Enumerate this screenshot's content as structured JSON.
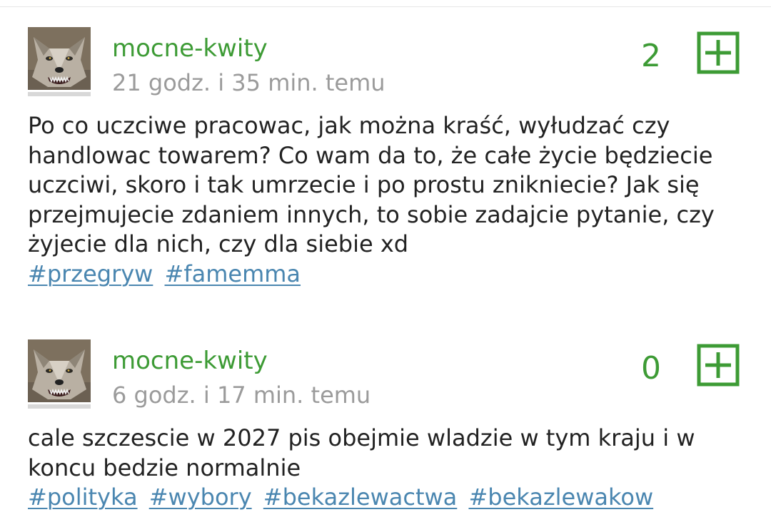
{
  "colors": {
    "accent_green": "#3d9b35",
    "tag_blue": "#4a86b0",
    "timestamp_gray": "#9b9b9b",
    "body_text": "#222222"
  },
  "posts": [
    {
      "username": "mocne-kwity",
      "timestamp": "21 godz. i 35 min. temu",
      "votes": "2",
      "vote_icon": "plus-square-icon",
      "avatar_icon": "wolf-avatar",
      "body": "Po co uczciwe pracowac, jak można kraść, wyłudzać czy handlowac towarem? Co wam da to, że całe życie będziecie uczciwi, skoro i tak umrzecie i po prostu znikniecie? Jak się przejmujecie zdaniem innych, to sobie zadajcie pytanie, czy żyjecie dla nich, czy dla siebie xd",
      "tags": [
        "#przegryw",
        "#famemma"
      ]
    },
    {
      "username": "mocne-kwity",
      "timestamp": "6 godz. i 17 min. temu",
      "votes": "0",
      "vote_icon": "plus-square-icon",
      "avatar_icon": "wolf-avatar",
      "body": "cale szczescie w 2027 pis obejmie wladzie w tym kraju i w koncu bedzie normalnie",
      "tags": [
        "#polityka",
        "#wybory",
        "#bekazlewactwa",
        "#bekazlewakow"
      ]
    }
  ]
}
